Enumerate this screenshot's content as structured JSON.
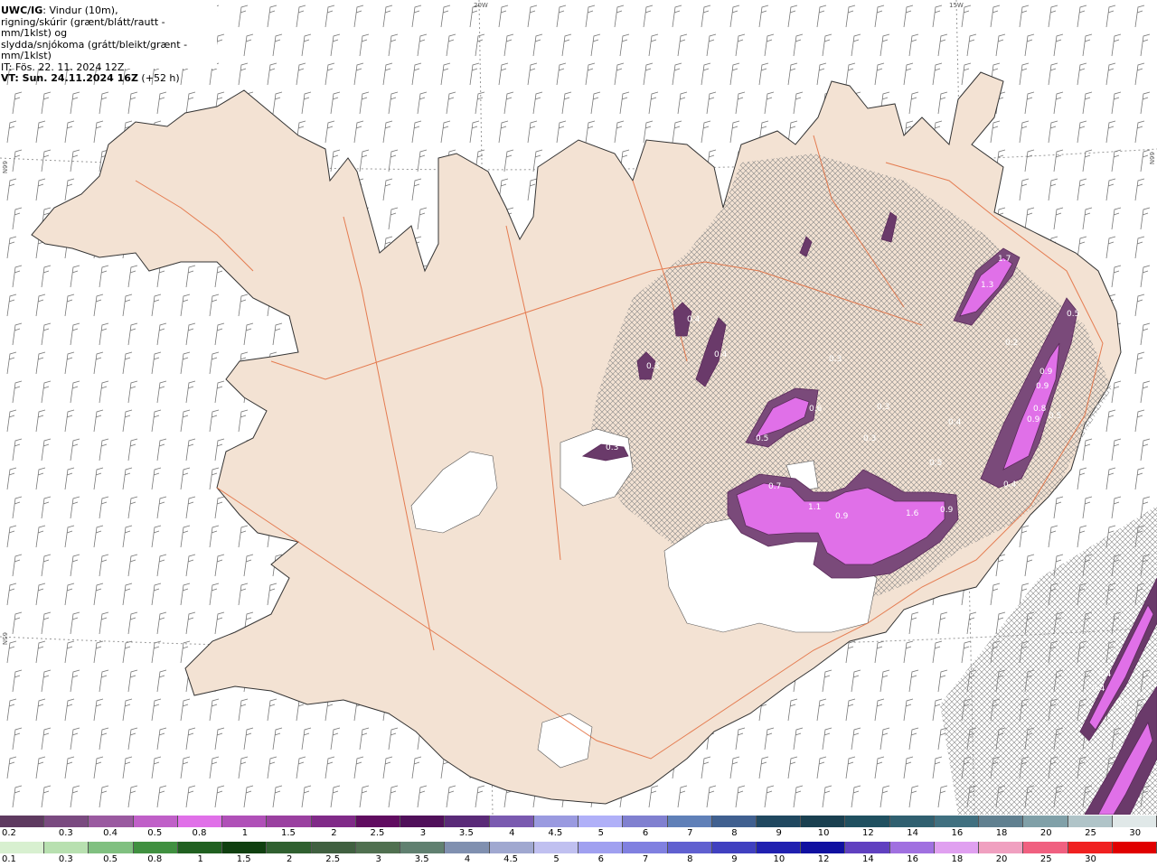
{
  "header": {
    "title": "UWC/IG",
    "line1_rest": ": Vindur (10m),",
    "line2": "rigning/skúrir (grænt/blátt/rautt - mm/1klst) og",
    "line3": "slydda/snjókoma (grátt/bleikt/grænt - mm/1klst)",
    "issue_time": "IT: Fös. 22. 11. 2024 12Z",
    "valid_prefix": "VT: Sun. 24.11.2024 16Z",
    "valid_suffix": " (+52 h)"
  },
  "graticule_labels": [
    "20W",
    "15W",
    "66N",
    "66N",
    "65N"
  ],
  "precip_values": [
    "0.4",
    "0.3",
    "0.4",
    "0.3",
    "0.3",
    "0.5",
    "0.6",
    "0.7",
    "1.1",
    "0.9",
    "1.6",
    "0.9",
    "1.7",
    "1.3",
    "0.5",
    "0.9",
    "0.9",
    "0.8",
    "0.9",
    "0.5",
    "0.4",
    "0.4",
    "0.4",
    "0.3",
    "0.5",
    "0.4",
    "0.2",
    "0.3",
    "0.3"
  ],
  "legend_snow": {
    "labels": [
      "0.2",
      "0.3",
      "0.4",
      "0.5",
      "0.8",
      "1",
      "1.5",
      "2",
      "2.5",
      "3",
      "3.5",
      "4",
      "4.5",
      "5",
      "6",
      "7",
      "8",
      "9",
      "10",
      "12",
      "14",
      "16",
      "18",
      "20",
      "25",
      "30"
    ],
    "colors": [
      "#5e3a60",
      "#7a4a80",
      "#9a5aa0",
      "#c060c8",
      "#e070e8",
      "#b050b8",
      "#9a40a0",
      "#802a88",
      "#600c60",
      "#50105a",
      "#5a2a78",
      "#7a5ab0",
      "#9a9ae0",
      "#b0b0f8",
      "#8080d0",
      "#6080b8",
      "#406090",
      "#204860",
      "#1a4050",
      "#205060",
      "#306070",
      "#407080",
      "#608090",
      "#80a0a8",
      "#b0c4c8",
      "#e0e8e8"
    ]
  },
  "legend_rain": {
    "labels": [
      "0.1",
      "0.3",
      "0.5",
      "0.8",
      "1",
      "1.5",
      "2",
      "2.5",
      "3",
      "3.5",
      "4",
      "4.5",
      "5",
      "6",
      "7",
      "8",
      "9",
      "10",
      "12",
      "14",
      "16",
      "18",
      "20",
      "25",
      "30"
    ],
    "colors": [
      "#d8f0d0",
      "#b8e0b0",
      "#80c080",
      "#409040",
      "#206020",
      "#104010",
      "#306030",
      "#406040",
      "#507050",
      "#608070",
      "#8090b0",
      "#a0a8d0",
      "#c0c0f0",
      "#a0a0f0",
      "#8080e0",
      "#6060d0",
      "#4040c0",
      "#2020b0",
      "#1010a0",
      "#6040c0",
      "#a070e0",
      "#e0a0f0",
      "#f0a0c0",
      "#f06080",
      "#f02020",
      "#e00000"
    ]
  }
}
